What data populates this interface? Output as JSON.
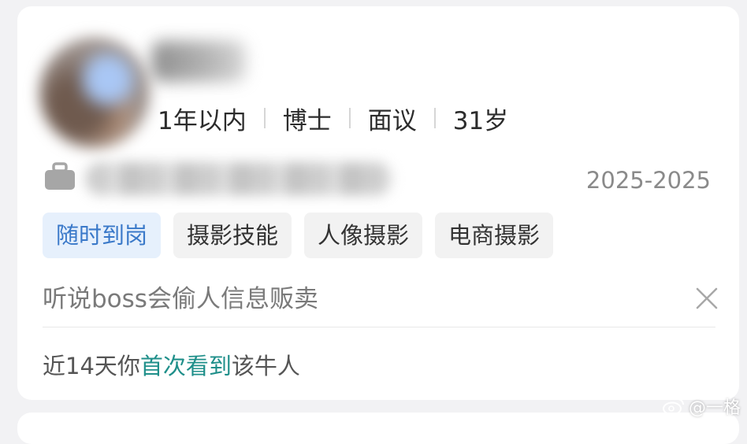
{
  "candidate": {
    "meta": [
      "1年以内",
      "博士",
      "面议",
      "31岁"
    ],
    "experience_years": "2025-2025",
    "tags": [
      {
        "label": "随时到岗",
        "highlight": true
      },
      {
        "label": "摄影技能",
        "highlight": false
      },
      {
        "label": "人像摄影",
        "highlight": false
      },
      {
        "label": "电商摄影",
        "highlight": false
      }
    ],
    "remark": "听说boss会偷人信息贩卖",
    "footer": {
      "prefix": "近14天你",
      "highlight": "首次看到",
      "suffix": "该牛人"
    }
  },
  "watermark": "@一格",
  "colors": {
    "tag_highlight_text": "#3a79c9",
    "tag_highlight_bg": "#e6f0fc",
    "footer_highlight": "#1f8f8a"
  },
  "icons": [
    "briefcase-icon",
    "close-icon",
    "weibo-icon"
  ]
}
